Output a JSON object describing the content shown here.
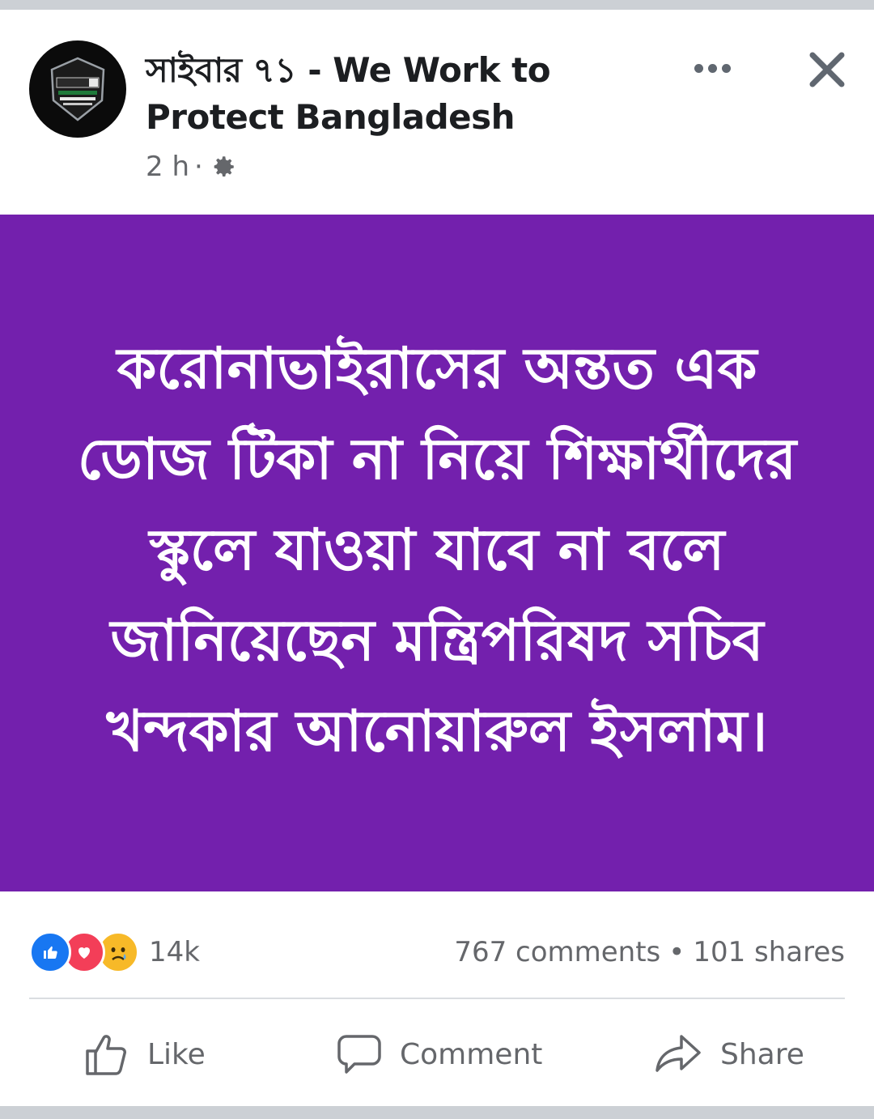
{
  "post": {
    "page_name": "সাইবার ৭১ - We Work to Protect Bangladesh",
    "time": "2 h",
    "dot": "·",
    "avatar_logo_text": "CYBER71",
    "body_text": "করোনাভাইরাসের অন্তত এক ডোজ টিকা না নিয়ে শিক্ষার্থীদের স্কুলে যাওয়া যাবে না বলে জানিয়েছেন মন্ত্রিপরিষদ সচিব খন্দকার আনোয়ারুল ইসলাম।",
    "background_color": "#7320ad"
  },
  "engagement": {
    "reaction_count": "14k",
    "comments": "767 comments",
    "separator": "•",
    "shares": "101 shares",
    "reactions": [
      "like-icon",
      "love-icon",
      "sad-icon"
    ]
  },
  "actions": {
    "like": "Like",
    "comment": "Comment",
    "share": "Share"
  }
}
